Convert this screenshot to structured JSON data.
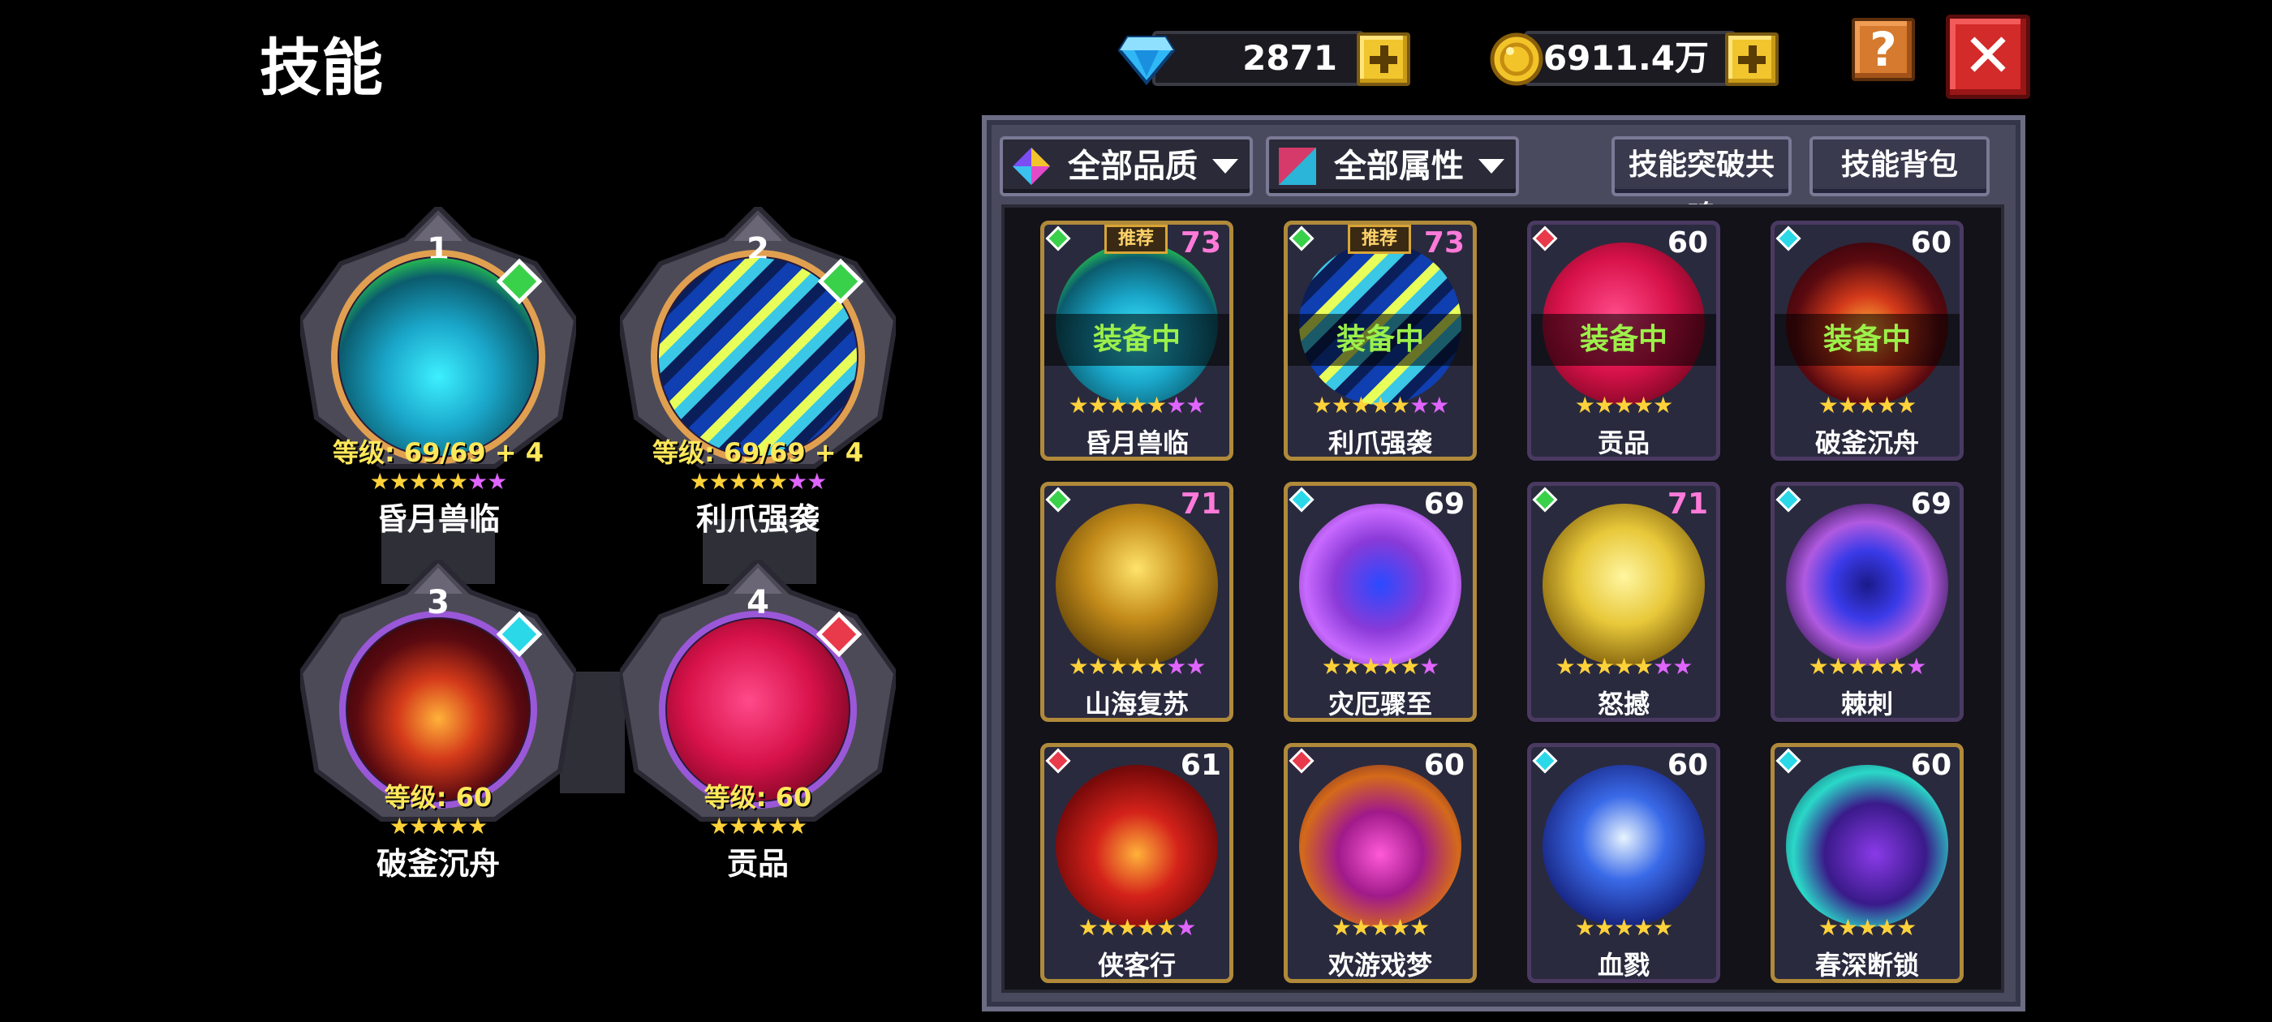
{
  "header": {
    "title": "技能",
    "gems": "2871",
    "gold": "6911.4万",
    "help_label": "?",
    "close_label": "✕"
  },
  "filters": {
    "quality": "全部品质",
    "attribute": "全部属性",
    "breakthrough": "技能突破共鸣",
    "bag": "技能背包"
  },
  "slots": [
    {
      "num": "1",
      "level": "等级: 69/69 + 4",
      "name": "昏月兽临",
      "gold_stars": 5,
      "purple_stars": 2,
      "element": "green"
    },
    {
      "num": "2",
      "level": "等级: 69/69 + 4",
      "name": "利爪强袭",
      "gold_stars": 5,
      "purple_stars": 2,
      "element": "green"
    },
    {
      "num": "3",
      "level": "等级: 60",
      "name": "破釜沉舟",
      "gold_stars": 5,
      "purple_stars": 0,
      "element": "cyan"
    },
    {
      "num": "4",
      "level": "等级: 60",
      "name": "贡品",
      "gold_stars": 5,
      "purple_stars": 0,
      "element": "red"
    }
  ],
  "cards": [
    {
      "name": "昏月兽临",
      "level": "73",
      "status": "装备中",
      "tag": "推荐",
      "gold_stars": 5,
      "purple_stars": 2,
      "element": "green",
      "level_color": "#ff7ad9",
      "orb": "teal"
    },
    {
      "name": "利爪强袭",
      "level": "73",
      "status": "装备中",
      "tag": "推荐",
      "gold_stars": 5,
      "purple_stars": 2,
      "element": "green",
      "level_color": "#ff7ad9",
      "orb": "stripe"
    },
    {
      "name": "贡品",
      "level": "60",
      "status": "装备中",
      "tag": "",
      "gold_stars": 5,
      "purple_stars": 0,
      "element": "red",
      "level_color": "#ffffff",
      "orb": "crimson"
    },
    {
      "name": "破釜沉舟",
      "level": "60",
      "status": "装备中",
      "tag": "",
      "gold_stars": 5,
      "purple_stars": 0,
      "element": "cyan",
      "level_color": "#ffffff",
      "orb": "demon"
    },
    {
      "name": "山海复苏",
      "level": "71",
      "status": "",
      "tag": "",
      "gold_stars": 5,
      "purple_stars": 2,
      "element": "green",
      "level_color": "#ff7ad9",
      "orb": "golden"
    },
    {
      "name": "灾厄骤至",
      "level": "69",
      "status": "",
      "tag": "",
      "gold_stars": 5,
      "purple_stars": 1,
      "element": "cyan",
      "level_color": "#ffffff",
      "orb": "violet"
    },
    {
      "name": "怒撼",
      "level": "71",
      "status": "",
      "tag": "",
      "gold_stars": 5,
      "purple_stars": 2,
      "element": "green",
      "level_color": "#ff7ad9",
      "orb": "yellow"
    },
    {
      "name": "棘刺",
      "level": "69",
      "status": "",
      "tag": "",
      "gold_stars": 5,
      "purple_stars": 1,
      "element": "cyan",
      "level_color": "#ffffff",
      "orb": "swirl"
    },
    {
      "name": "侠客行",
      "level": "61",
      "status": "",
      "tag": "",
      "gold_stars": 5,
      "purple_stars": 1,
      "element": "red",
      "level_color": "#ffffff",
      "orb": "redmask"
    },
    {
      "name": "欢游戏梦",
      "level": "60",
      "status": "",
      "tag": "",
      "gold_stars": 5,
      "purple_stars": 0,
      "element": "red",
      "level_color": "#ffffff",
      "orb": "mask"
    },
    {
      "name": "血戮",
      "level": "60",
      "status": "",
      "tag": "",
      "gold_stars": 5,
      "purple_stars": 0,
      "element": "cyan",
      "level_color": "#ffffff",
      "orb": "bluemoon"
    },
    {
      "name": "春深断锁",
      "level": "60",
      "status": "",
      "tag": "",
      "gold_stars": 5,
      "purple_stars": 0,
      "element": "cyan",
      "level_color": "#ffffff",
      "orb": "chain"
    }
  ]
}
